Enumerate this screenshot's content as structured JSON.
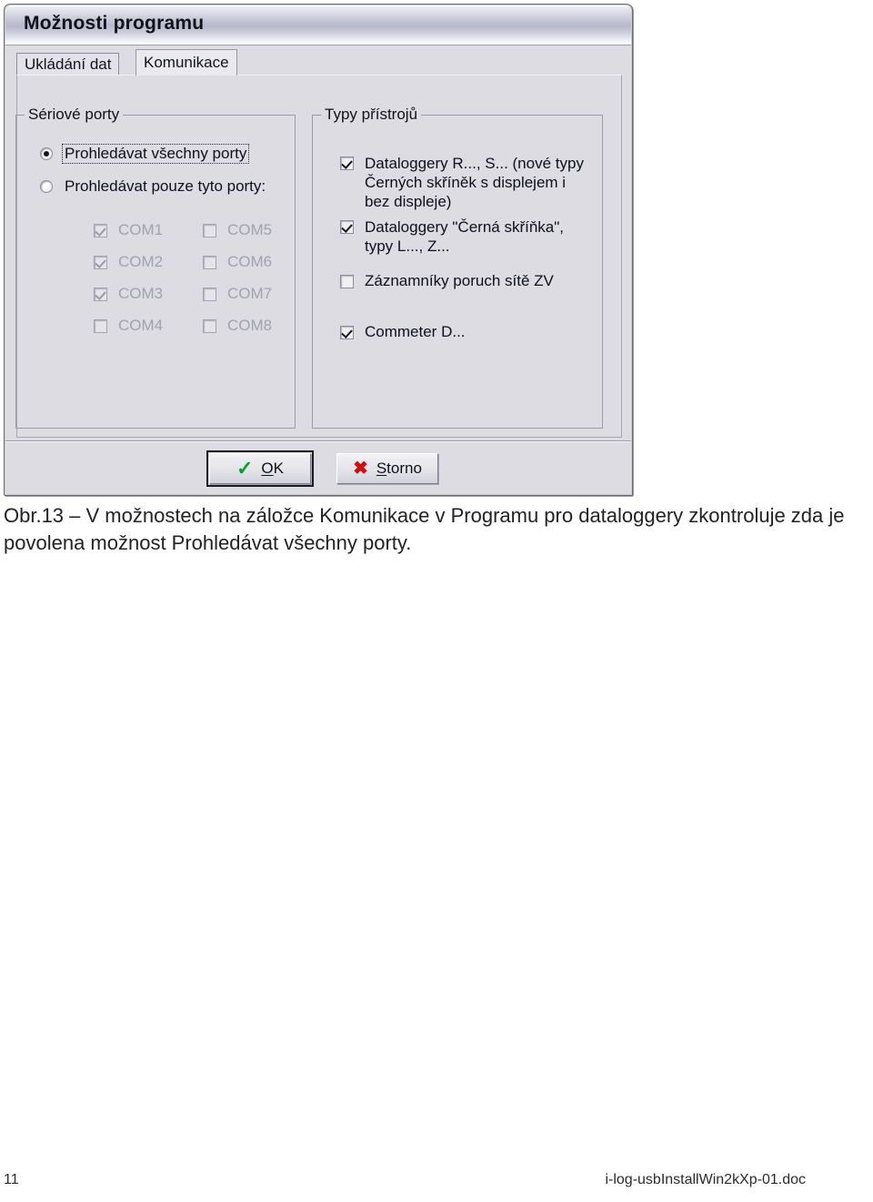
{
  "dialog": {
    "title": "Možnosti programu",
    "tabs": [
      {
        "label": "Ukládání dat",
        "active": false
      },
      {
        "label": "Komunikace",
        "active": true
      }
    ],
    "serial_ports_group": {
      "title": "Sériové porty",
      "radios": [
        {
          "label": "Prohledávat všechny porty",
          "selected": true,
          "focused": true
        },
        {
          "label": "Prohledávat pouze tyto porty:",
          "selected": false,
          "focused": false
        }
      ],
      "ports": [
        {
          "label": "COM1",
          "checked": true,
          "enabled": false
        },
        {
          "label": "COM2",
          "checked": true,
          "enabled": false
        },
        {
          "label": "COM3",
          "checked": true,
          "enabled": false
        },
        {
          "label": "COM4",
          "checked": false,
          "enabled": false
        },
        {
          "label": "COM5",
          "checked": false,
          "enabled": false
        },
        {
          "label": "COM6",
          "checked": false,
          "enabled": false
        },
        {
          "label": "COM7",
          "checked": false,
          "enabled": false
        },
        {
          "label": "COM8",
          "checked": false,
          "enabled": false
        }
      ]
    },
    "device_types_group": {
      "title": "Typy přístrojů",
      "items": [
        {
          "label": "Dataloggery R..., S... (nové typy Černých skříněk s displejem i bez displeje)",
          "checked": true
        },
        {
          "label": "Dataloggery \"Černá skříňka\", typy L..., Z...",
          "checked": true
        },
        {
          "label": "Záznamníky poruch sítě ZV",
          "checked": false
        },
        {
          "label": "Commeter D...",
          "checked": true
        }
      ]
    },
    "buttons": {
      "ok": {
        "icon": "check-icon",
        "text_before": "",
        "accel": "O",
        "text_after": "K",
        "color": "#00a32a"
      },
      "cancel": {
        "icon": "cross-icon",
        "accel": "S",
        "text_after": "torno",
        "color": "#cc1111"
      }
    }
  },
  "caption": "Obr.13 – V možnostech na záložce Komunikace v Programu pro dataloggery zkontroluje zda je povolena možnost Prohledávat všechny porty.",
  "footer": {
    "page_number": "11",
    "file_name": "i-log-usbInstallWin2kXp-01.doc"
  }
}
